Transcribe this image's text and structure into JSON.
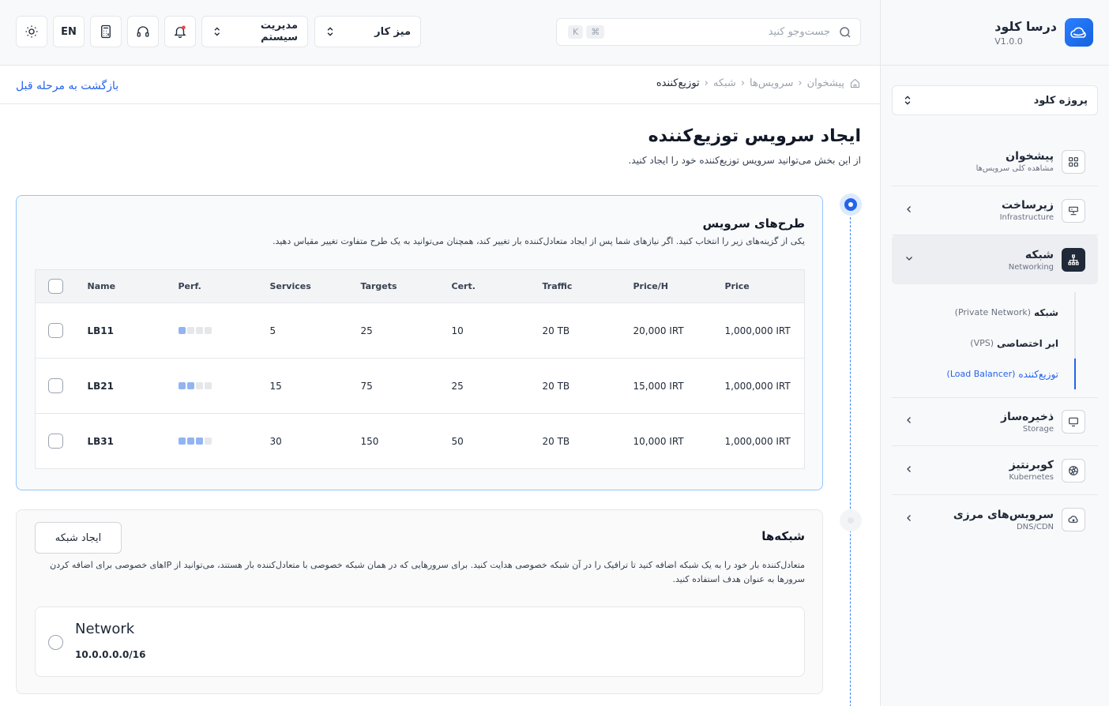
{
  "brand": {
    "name": "درسا کلود",
    "version": "V1.0.0"
  },
  "project": {
    "selected": "پروژه کلود"
  },
  "nav": {
    "items": [
      {
        "title": "پیشخوان",
        "subtitle": "مشاهده کلی سرویس‌ها"
      },
      {
        "title": "زیرساخت",
        "subtitle": "Infrastructure"
      },
      {
        "title": "شبکه",
        "subtitle": "Networking"
      },
      {
        "title": "ذخیره‌ساز",
        "subtitle": "Storage"
      },
      {
        "title": "کوبرنتیز",
        "subtitle": "Kubernetes"
      },
      {
        "title": "سرویس‌های مرزی",
        "subtitle": "DNS/CDN"
      }
    ],
    "sub": [
      {
        "fa": "شبکه",
        "en": "(Private Network)"
      },
      {
        "fa": "ابر اختصاصی",
        "en": "(VPS)"
      },
      {
        "fa": "توزیع‌کننده",
        "en": "(Load Balancer)"
      }
    ]
  },
  "topbar": {
    "search_placeholder": "جست‌وجو کنید",
    "kbd_k": "K",
    "kbd_cmd": "⌘",
    "workspace": "میز کار",
    "system": "مدیریت سیستم",
    "lang": "EN"
  },
  "breadcrumb": [
    "پیشخوان",
    "سرویس‌ها",
    "شبکه",
    "توزیع‌کننده"
  ],
  "back_label": "بازگشت به مرحله قبل",
  "page": {
    "title": "ایجاد سرویس توزیع‌کننده",
    "subtitle": "از این بخش می‌توانید سرویس توزیع‌کننده خود را ایجاد کنید."
  },
  "plans": {
    "title": "طرح‌های سرویس",
    "desc": "یکی از گزینه‌های زیر را انتخاب کنید. اگر نیازهای شما پس از ایجاد متعادل‌کننده بار تغییر کند، همچنان می‌توانید به یک طرح متفاوت تغییر مقیاس دهید.",
    "columns": [
      "Name",
      "Perf.",
      "Services",
      "Targets",
      "Cert.",
      "Traffic",
      "Price/H",
      "Price"
    ],
    "rows": [
      {
        "name": "LB11",
        "perf": 1,
        "services": "5",
        "targets": "25",
        "cert": "10",
        "traffic": "20 TB",
        "price_h": "20,000 IRT",
        "price": "1,000,000 IRT"
      },
      {
        "name": "LB21",
        "perf": 2,
        "services": "15",
        "targets": "75",
        "cert": "25",
        "traffic": "20 TB",
        "price_h": "15,000 IRT",
        "price": "1,000,000 IRT"
      },
      {
        "name": "LB31",
        "perf": 3,
        "services": "30",
        "targets": "150",
        "cert": "50",
        "traffic": "20 TB",
        "price_h": "10,000 IRT",
        "price": "1,000,000 IRT"
      }
    ]
  },
  "networks": {
    "title": "شبکه‌ها",
    "create_label": "ایجاد شبکه",
    "desc1": "متعادل‌کننده بار خود را به یک شبکه اضافه کنید تا ترافیک را در آن شبکه خصوصی هدایت کنید. برای سرورهایی که در همان شبکه خصوصی با متعادل‌کننده بار هستند، می‌توانید از IPهای خصوصی برای اضافه کردن",
    "desc2": "سرورها به عنوان هدف استفاده کنید.",
    "option": {
      "name": "Network",
      "cidr": "10.0.0.0.0/16"
    }
  },
  "colors": {
    "accent": "#2563eb",
    "price": "#1d4ed8"
  }
}
